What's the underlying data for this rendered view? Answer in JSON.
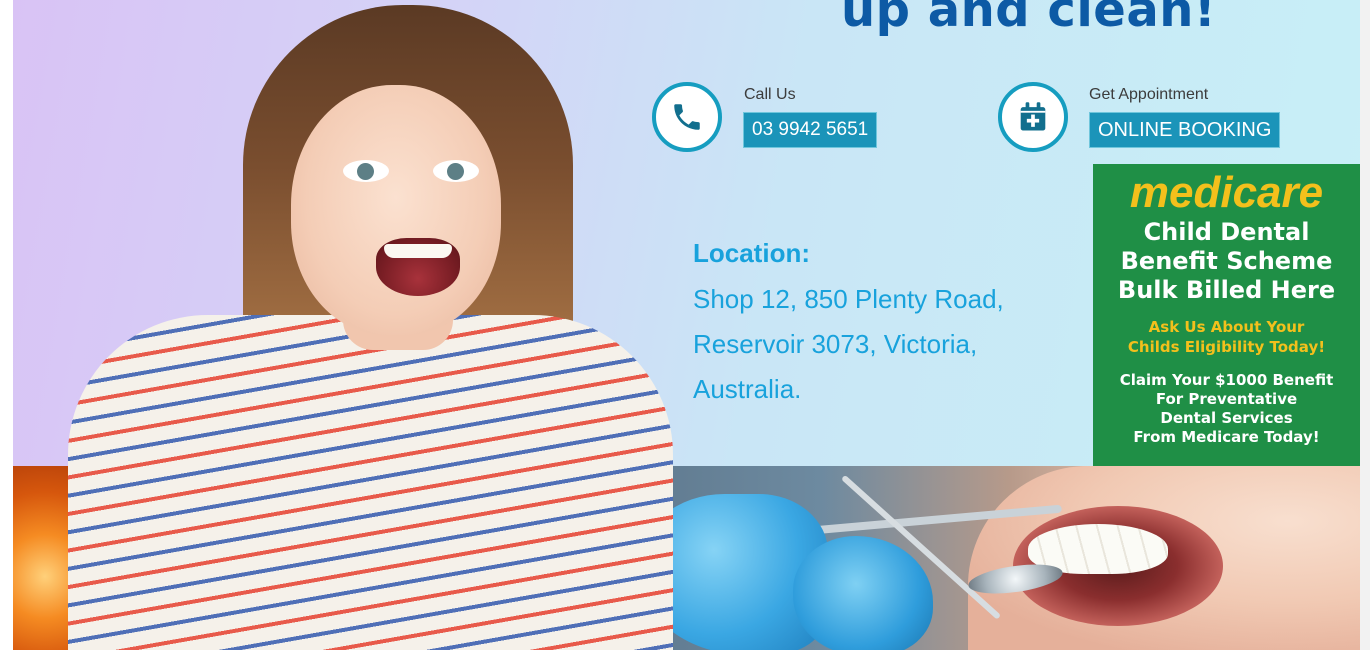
{
  "headline": "up and clean!",
  "call": {
    "label": "Call Us",
    "phone": "03 9942 5651",
    "icon": "phone-icon"
  },
  "appointment": {
    "label": "Get Appointment",
    "button": "ONLINE BOOKING",
    "icon": "calendar-plus-icon"
  },
  "location": {
    "title": "Location:",
    "lines": [
      "Shop 12, 850 Plenty Road,",
      "Reservoir 3073, Victoria,",
      "Australia."
    ]
  },
  "medicare": {
    "logo": "medicare",
    "scheme_lines": [
      "Child Dental",
      "Benefit Scheme",
      "Bulk Billed Here"
    ],
    "ask_lines": [
      "Ask Us About Your",
      "Childs Eligibility Today!"
    ],
    "claim_lines": [
      "Claim Your $1000 Benefit",
      "For Preventative",
      "Dental Services",
      "From Medicare Today!"
    ]
  },
  "colors": {
    "accent": "#1b94b9",
    "headline": "#0d5aa5",
    "location_text": "#18a2dc",
    "medicare_green": "#1f8f46",
    "medicare_yellow": "#f3c01c"
  }
}
